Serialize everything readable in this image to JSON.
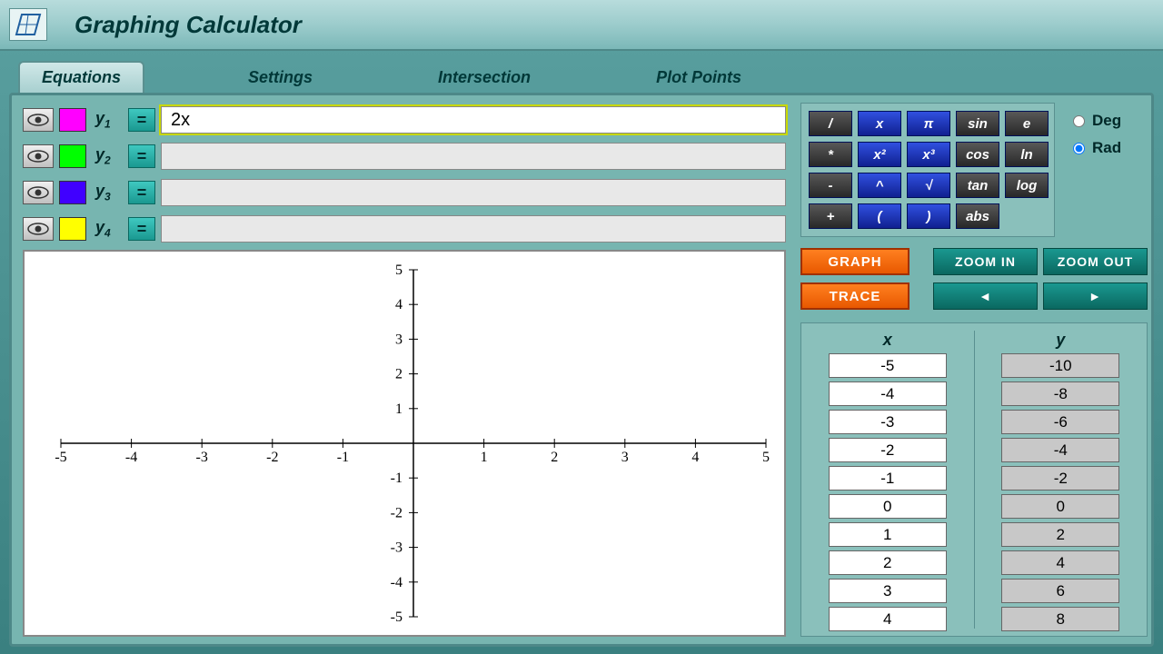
{
  "app": {
    "title": "Graphing Calculator"
  },
  "tabs": [
    "Equations",
    "Settings",
    "Intersection",
    "Plot Points"
  ],
  "equations": [
    {
      "label": "y",
      "sub": "1",
      "color": "#ff00ff",
      "value": "2x",
      "active": true
    },
    {
      "label": "y",
      "sub": "2",
      "color": "#00ff00",
      "value": "",
      "active": false
    },
    {
      "label": "y",
      "sub": "3",
      "color": "#4000ff",
      "value": "",
      "active": false
    },
    {
      "label": "y",
      "sub": "4",
      "color": "#ffff00",
      "value": "",
      "active": false
    }
  ],
  "keypad": [
    [
      "/",
      "x",
      "π",
      "sin",
      "e"
    ],
    [
      "*",
      "x²",
      "x³",
      "cos",
      "ln"
    ],
    [
      "-",
      "^",
      "√",
      "tan",
      "log"
    ],
    [
      "+",
      "(",
      ")",
      "abs",
      ""
    ]
  ],
  "angle": {
    "deg": "Deg",
    "rad": "Rad",
    "selected": "rad"
  },
  "controls": {
    "graph": "GRAPH",
    "trace": "TRACE",
    "zoom_in": "ZOOM IN",
    "zoom_out": "ZOOM OUT",
    "left": "◄",
    "right": "►"
  },
  "plot": {
    "xmin": -5,
    "xmax": 5,
    "ymin": -5,
    "ymax": 5
  },
  "table": {
    "xhead": "x",
    "yhead": "y",
    "x": [
      "-5",
      "-4",
      "-3",
      "-2",
      "-1",
      "0",
      "1",
      "2",
      "3",
      "4"
    ],
    "y": [
      "-10",
      "-8",
      "-6",
      "-4",
      "-2",
      "0",
      "2",
      "4",
      "6",
      "8"
    ]
  }
}
